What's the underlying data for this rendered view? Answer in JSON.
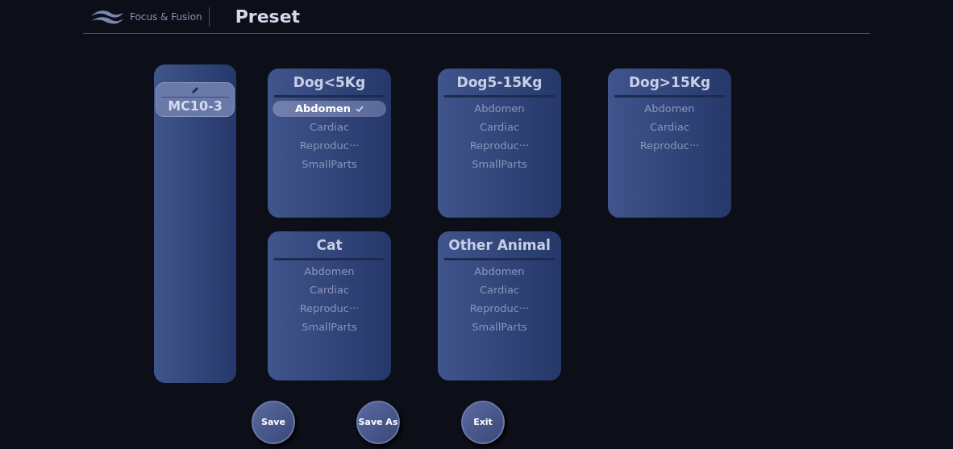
{
  "header": {
    "brand": "Focus & Fusion",
    "title": "Preset"
  },
  "probe": {
    "name": "MC10-3"
  },
  "groups": [
    {
      "title": "Dog<5Kg",
      "items": [
        {
          "label": "Abdomen",
          "selected": true
        },
        {
          "label": "Cardiac",
          "selected": false
        },
        {
          "label": "Reproduc···",
          "selected": false
        },
        {
          "label": "SmallParts",
          "selected": false
        }
      ]
    },
    {
      "title": "Dog5-15Kg",
      "items": [
        {
          "label": "Abdomen",
          "selected": false
        },
        {
          "label": "Cardiac",
          "selected": false
        },
        {
          "label": "Reproduc···",
          "selected": false
        },
        {
          "label": "SmallParts",
          "selected": false
        }
      ]
    },
    {
      "title": "Dog>15Kg",
      "items": [
        {
          "label": "Abdomen",
          "selected": false
        },
        {
          "label": "Cardiac",
          "selected": false
        },
        {
          "label": "Reproduc···",
          "selected": false
        }
      ]
    },
    {
      "title": "Cat",
      "items": [
        {
          "label": "Abdomen",
          "selected": false
        },
        {
          "label": "Cardiac",
          "selected": false
        },
        {
          "label": "Reproduc···",
          "selected": false
        },
        {
          "label": "SmallParts",
          "selected": false
        }
      ]
    },
    {
      "title": "Other Animal",
      "items": [
        {
          "label": "Abdomen",
          "selected": false
        },
        {
          "label": "Cardiac",
          "selected": false
        },
        {
          "label": "Reproduc···",
          "selected": false
        },
        {
          "label": "SmallParts",
          "selected": false
        }
      ]
    }
  ],
  "buttons": [
    "Save",
    "Save As",
    "Exit"
  ]
}
